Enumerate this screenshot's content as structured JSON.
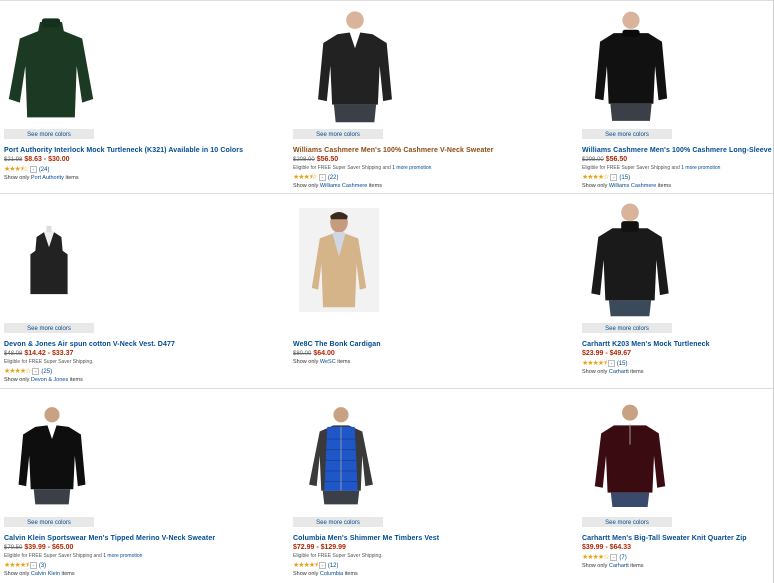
{
  "see_more_label": "See more colors",
  "products": [
    {
      "title": "Port Authority Interlock Mock Turtleneck (K321) Available in 10 Colors",
      "title_color": "blue",
      "was": "$21.98",
      "price": "$8.63 - $30.00",
      "eligible": "",
      "promo": "",
      "rating_count": "(24)",
      "stars": 3.5,
      "show_only_prefix": "Show only ",
      "show_only_brand": "Port Authority",
      "show_only_suffix": " items",
      "has_see_more": true
    },
    {
      "title": "Williams Cashmere Men's 100% Cashmere V-Neck Sweater",
      "title_color": "brown",
      "was": "$208.00",
      "price": "$56.50",
      "eligible": "Eligible for FREE Super Saver Shipping and ",
      "promo": "1 more promotion",
      "rating_count": "(22)",
      "stars": 3.5,
      "show_only_prefix": "Show only ",
      "show_only_brand": "Williams Cashmere",
      "show_only_suffix": " items",
      "has_see_more": true
    },
    {
      "title": "Williams Cashmere Men's 100% Cashmere Long-Sleeve C",
      "title_color": "blue",
      "was": "$208.00",
      "price": "$56.50",
      "eligible": "Eligible for FREE Super Saver Shipping and ",
      "promo": "1 more promotion",
      "rating_count": "(15)",
      "stars": 4,
      "show_only_prefix": "Show only ",
      "show_only_brand": "Williams Cashmere",
      "show_only_suffix": " items",
      "has_see_more": true
    },
    {
      "title": "Devon & Jones Air spun cotton V-Neck Vest. D477",
      "title_color": "blue",
      "was": "$48.08",
      "price": "$14.42 - $33.37",
      "eligible": "Eligible for FREE Super Saver Shipping.",
      "promo": "",
      "rating_count": "(25)",
      "stars": 4,
      "show_only_prefix": "Show only ",
      "show_only_brand": "Devon & Jones",
      "show_only_suffix": " items",
      "has_see_more": true
    },
    {
      "title": "We8C The Bonk Cardigan",
      "title_color": "blue",
      "was": "$80.00",
      "price": "$64.00",
      "eligible": "",
      "promo": "",
      "rating_count": "",
      "stars": 0,
      "show_only_prefix": "Show only ",
      "show_only_brand": "WeSC",
      "show_only_suffix": " items",
      "has_see_more": false
    },
    {
      "title": "Carhartt K203 Men's Mock Turtleneck",
      "title_color": "blue",
      "was": "",
      "price": "$23.99 - $49.67",
      "eligible": "",
      "promo": "",
      "rating_count": "(15)",
      "stars": 4.5,
      "show_only_prefix": "Show only ",
      "show_only_brand": "Carhartt",
      "show_only_suffix": " items",
      "has_see_more": true
    },
    {
      "title": "Calvin Klein Sportswear Men's Tipped Merino V-Neck Sweater",
      "title_color": "blue",
      "was": "$79.50",
      "price": "$39.99 - $65.00",
      "eligible": "Eligible for FREE Super Saver Shipping and ",
      "promo": "1 more promotion",
      "rating_count": "(3)",
      "stars": 4.5,
      "show_only_prefix": "Show only ",
      "show_only_brand": "Calvin Klein",
      "show_only_suffix": " items",
      "has_see_more": true
    },
    {
      "title": "Columbia Men's Shimmer Me Timbers Vest",
      "title_color": "blue",
      "was": "",
      "price": "$72.99 - $129.99",
      "eligible": "Eligible for FREE Super Saver Shipping.",
      "promo": "",
      "rating_count": "(12)",
      "stars": 4.5,
      "show_only_prefix": "Show only ",
      "show_only_brand": "Columbia",
      "show_only_suffix": " items",
      "has_see_more": true
    },
    {
      "title": "Carhartt Men's Big-Tall Sweater Knit Quarter Zip",
      "title_color": "blue",
      "was": "",
      "price": "$39.99 - $64.33",
      "eligible": "",
      "promo": "",
      "rating_count": "(7)",
      "stars": 4,
      "show_only_prefix": "Show only ",
      "show_only_brand": "Carhartt",
      "show_only_suffix": " items",
      "has_see_more": true
    }
  ],
  "colors": {
    "link": "#004b91",
    "price": "#b12704",
    "star": "#e8a317",
    "title_brown": "#8a4b13"
  }
}
